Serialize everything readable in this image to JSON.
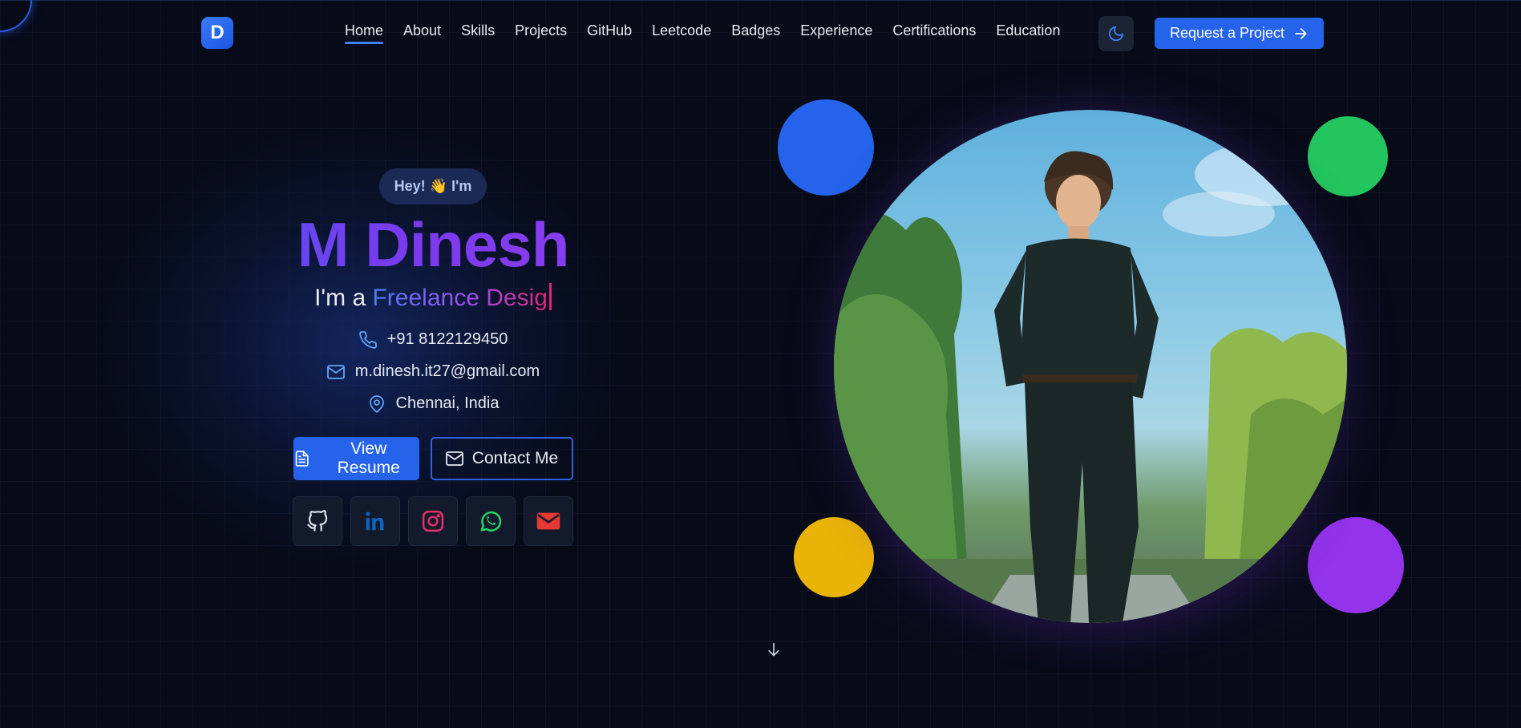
{
  "logo": {
    "letter": "D"
  },
  "nav": {
    "items": [
      {
        "label": "Home",
        "active": true
      },
      {
        "label": "About"
      },
      {
        "label": "Skills"
      },
      {
        "label": "Projects"
      },
      {
        "label": "GitHub"
      },
      {
        "label": "Leetcode"
      },
      {
        "label": "Badges"
      },
      {
        "label": "Experience"
      },
      {
        "label": "Certifications"
      },
      {
        "label": "Education"
      }
    ],
    "theme_icon": "moon-icon",
    "cta_label": "Request a Project",
    "cta_icon": "arrow-right-icon"
  },
  "hero": {
    "greeting": "Hey! 👋 I'm",
    "name": "M Dinesh",
    "role_prefix": "I'm a",
    "role_typed": "Freelance Desig",
    "contacts": {
      "phone": "+91 8122129450",
      "email": "m.dinesh.it27@gmail.com",
      "location": "Chennai, India"
    },
    "buttons": {
      "resume": "View Resume",
      "contact": "Contact Me"
    },
    "socials": [
      "github-icon",
      "linkedin-icon",
      "instagram-icon",
      "whatsapp-icon",
      "email-icon"
    ]
  },
  "colors": {
    "background": "#070b18",
    "accent": "#2563eb",
    "name_gradient_start": "#5b4df0",
    "name_gradient_end": "#8b3df0",
    "dot_blue": "#2563eb",
    "dot_green": "#22c55e",
    "dot_yellow": "#eab308",
    "dot_purple": "#9333ea"
  }
}
